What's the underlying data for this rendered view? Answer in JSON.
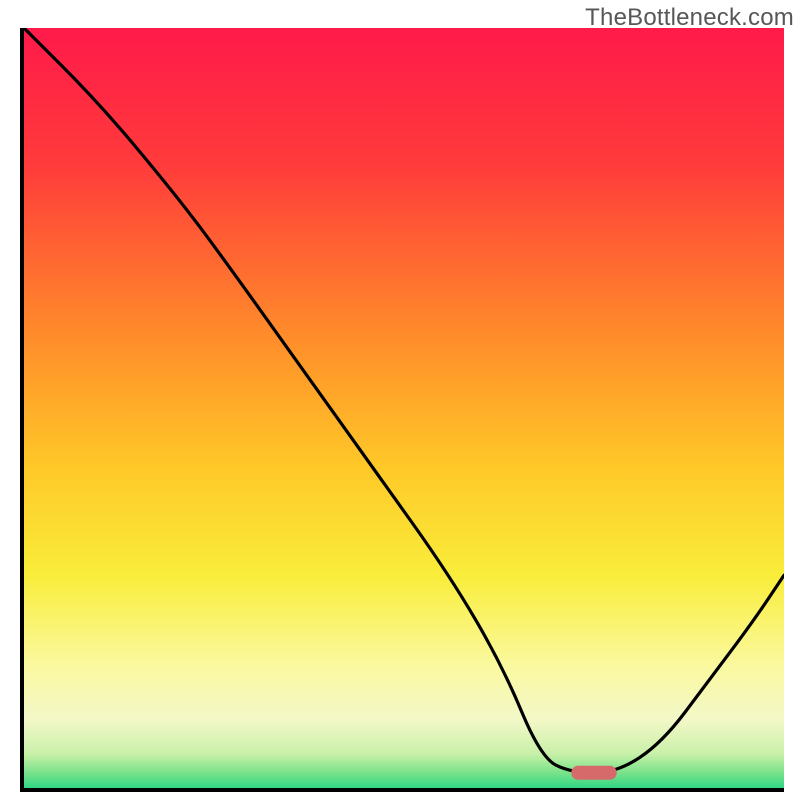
{
  "watermark": "TheBottleneck.com",
  "chart_data": {
    "type": "line",
    "title": "",
    "xlabel": "",
    "ylabel": "",
    "xlim": [
      0,
      100
    ],
    "ylim": [
      0,
      100
    ],
    "grid": false,
    "series": [
      {
        "name": "curve",
        "x": [
          0,
          10,
          20,
          26,
          36,
          46,
          56,
          63,
          68,
          72,
          78,
          84,
          90,
          96,
          100
        ],
        "y": [
          100,
          90,
          78,
          70,
          56,
          42,
          28,
          16,
          4,
          2,
          2,
          6,
          14,
          22,
          28
        ]
      }
    ],
    "marker": {
      "name": "optimal-marker",
      "x_center": 75,
      "y": 2,
      "width": 6,
      "color": "#d66a6a"
    },
    "background_gradient_stops": [
      {
        "offset": 0.0,
        "color": "#ff1a4a"
      },
      {
        "offset": 0.18,
        "color": "#ff3b3b"
      },
      {
        "offset": 0.4,
        "color": "#ff8a2a"
      },
      {
        "offset": 0.58,
        "color": "#ffc928"
      },
      {
        "offset": 0.72,
        "color": "#f9ed3a"
      },
      {
        "offset": 0.84,
        "color": "#faf9a0"
      },
      {
        "offset": 0.91,
        "color": "#f3f8c8"
      },
      {
        "offset": 0.955,
        "color": "#c9f0a8"
      },
      {
        "offset": 0.98,
        "color": "#79e28a"
      },
      {
        "offset": 1.0,
        "color": "#31d684"
      }
    ]
  }
}
